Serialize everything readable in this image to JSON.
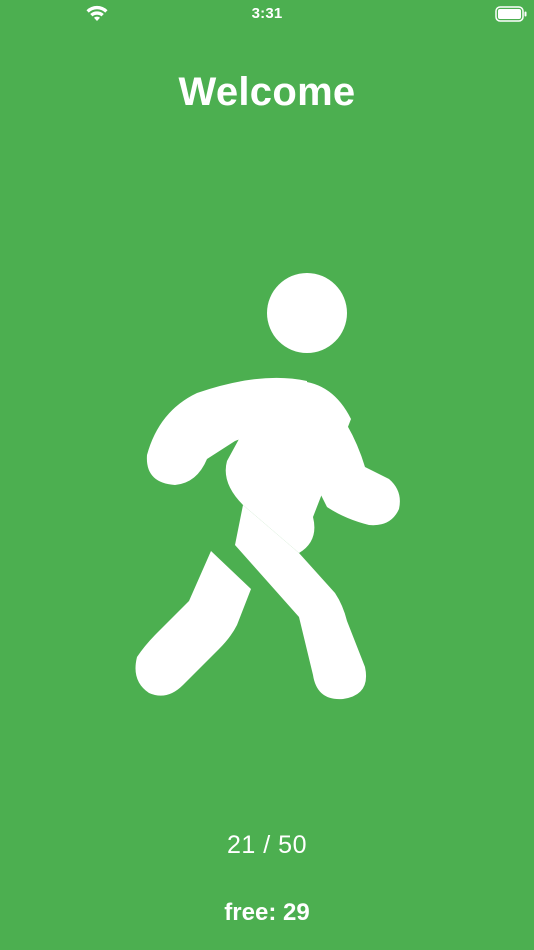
{
  "status_bar": {
    "time": "3:31",
    "wifi_icon": "wifi-icon",
    "battery_icon": "battery-full-icon"
  },
  "header": {
    "title": "Welcome"
  },
  "main": {
    "icon": "walking-person-icon",
    "steps_text": "21 / 50",
    "free_text": "free: 29"
  },
  "colors": {
    "background": "#4caf50",
    "foreground": "#ffffff"
  }
}
